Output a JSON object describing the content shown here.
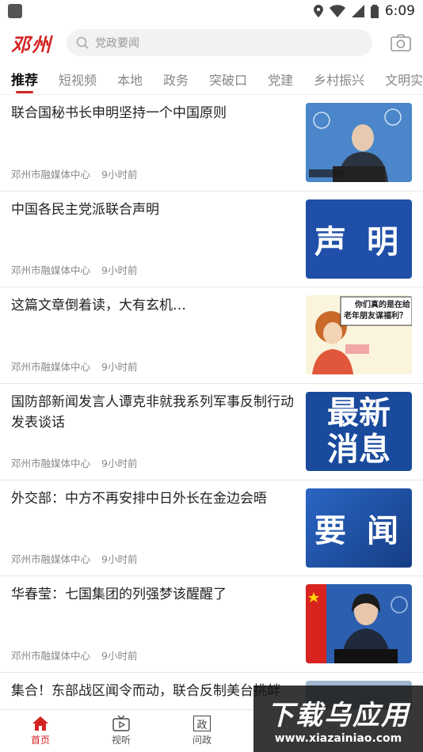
{
  "status_bar": {
    "time": "6:09"
  },
  "header": {
    "logo": "邓州",
    "search_placeholder": "党政要闻"
  },
  "tabs": [
    "推荐",
    "短视频",
    "本地",
    "政务",
    "突破口",
    "党建",
    "乡村振兴",
    "文明实践"
  ],
  "feed": [
    {
      "title": "联合国秘书长申明坚持一个中国原则",
      "source": "邓州市融媒体中心",
      "time": "9小时前",
      "thumb": "un-photo"
    },
    {
      "title": "中国各民主党派联合声明",
      "source": "邓州市融媒体中心",
      "time": "9小时前",
      "thumb": "声明",
      "thumb_text": "声 明"
    },
    {
      "title": "这篇文章倒着读，大有玄机…",
      "source": "邓州市融媒体中心",
      "time": "9小时前",
      "thumb": "cartoon",
      "thumb_caption_1": "你们真的是在给",
      "thumb_caption_2": "老年朋友谋福利？"
    },
    {
      "title": "国防部新闻发言人谭克非就我系列军事反制行动发表谈话",
      "source": "邓州市融媒体中心",
      "time": "9小时前",
      "thumb": "最新消息",
      "thumb_text_1": "最新",
      "thumb_text_2": "消息"
    },
    {
      "title": "外交部：中方不再安排中日外长在金边会晤",
      "source": "邓州市融媒体中心",
      "time": "9小时前",
      "thumb": "要闻",
      "thumb_text": "要 闻"
    },
    {
      "title": "华春莹：七国集团的列强梦该醒醒了",
      "source": "邓州市融媒体中心",
      "time": "9小时前",
      "thumb": "press"
    },
    {
      "title": "集合！东部战区闻令而动，联合反制美台挑衅",
      "source": "",
      "time": "",
      "thumb": "partial"
    }
  ],
  "bottom_nav": [
    {
      "label": "首页",
      "icon": "home-icon",
      "active": true
    },
    {
      "label": "视听",
      "icon": "tv-icon",
      "active": false
    },
    {
      "label": "问政",
      "icon": "zheng-icon",
      "icon_text": "政",
      "active": false
    }
  ],
  "watermark": {
    "big": "下载乌应用",
    "small": "www.xiazainiao.com"
  },
  "colors": {
    "accent": "#d42323",
    "blue": "#1f4fa8"
  }
}
